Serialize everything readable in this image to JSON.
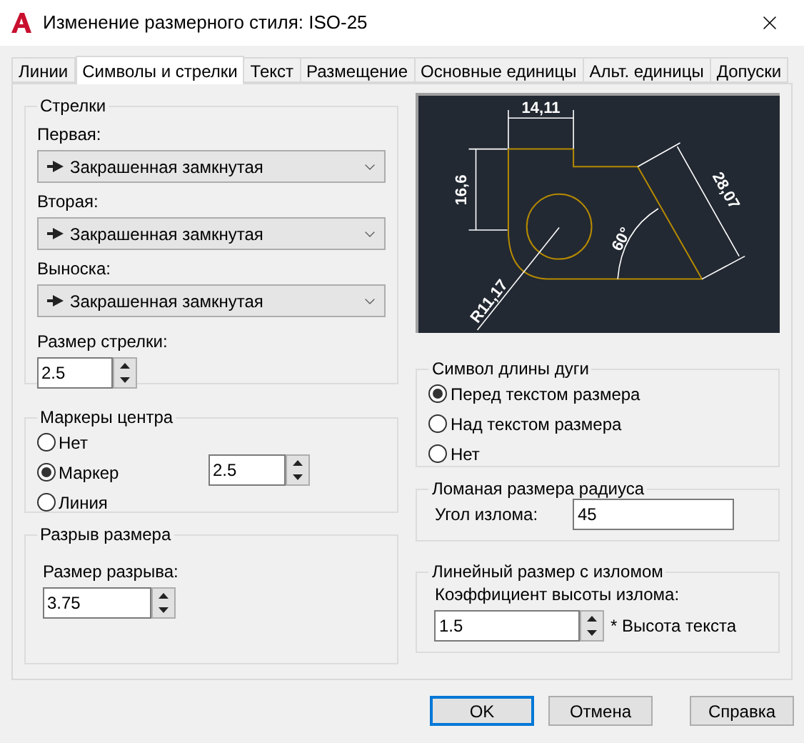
{
  "window": {
    "title": "Изменение размерного стиля: ISO-25"
  },
  "tabs": [
    {
      "label": "Линии",
      "selected": false
    },
    {
      "label": "Символы и стрелки",
      "selected": true
    },
    {
      "label": "Текст",
      "selected": false
    },
    {
      "label": "Размещение",
      "selected": false
    },
    {
      "label": "Основные единицы",
      "selected": false
    },
    {
      "label": "Альт. единицы",
      "selected": false
    },
    {
      "label": "Допуски",
      "selected": false
    }
  ],
  "arrowheads": {
    "title": "Стрелки",
    "fields": [
      {
        "label": "Первая:",
        "value": "Закрашенная замкнутая"
      },
      {
        "label": "Вторая:",
        "value": "Закрашенная замкнутая"
      },
      {
        "label": "Выноска:",
        "value": "Закрашенная замкнутая"
      }
    ],
    "size": {
      "label": "Размер стрелки:",
      "value": "2.5"
    }
  },
  "center_marks": {
    "title": "Маркеры центра",
    "options": [
      {
        "label": "Нет",
        "selected": false
      },
      {
        "label": "Маркер",
        "selected": true
      },
      {
        "label": "Линия",
        "selected": false
      }
    ],
    "size": {
      "value": "2.5"
    }
  },
  "dimension_break": {
    "title": "Разрыв размера",
    "label": "Размер разрыва:",
    "value": "3.75"
  },
  "preview": {
    "labels": [
      "14,11",
      "16,6",
      "28,07",
      "60°",
      "R11,17"
    ]
  },
  "arc_length_symbol": {
    "title": "Символ длины дуги",
    "options": [
      {
        "label": "Перед текстом размера",
        "selected": true
      },
      {
        "label": "Над текстом размера",
        "selected": false
      },
      {
        "label": "Нет",
        "selected": false
      }
    ]
  },
  "radius_jog": {
    "title": "Ломаная размера радиуса",
    "label": "Угол излома:",
    "value": "45"
  },
  "linear_jog": {
    "title": "Линейный размер с изломом",
    "label": "Коэффициент высоты излома:",
    "value": "1.5",
    "suffix": "* Высота текста"
  },
  "buttons": [
    {
      "label": "OK",
      "focused": true
    },
    {
      "label": "Отмена",
      "focused": false
    },
    {
      "label": "Справка",
      "focused": false
    }
  ]
}
